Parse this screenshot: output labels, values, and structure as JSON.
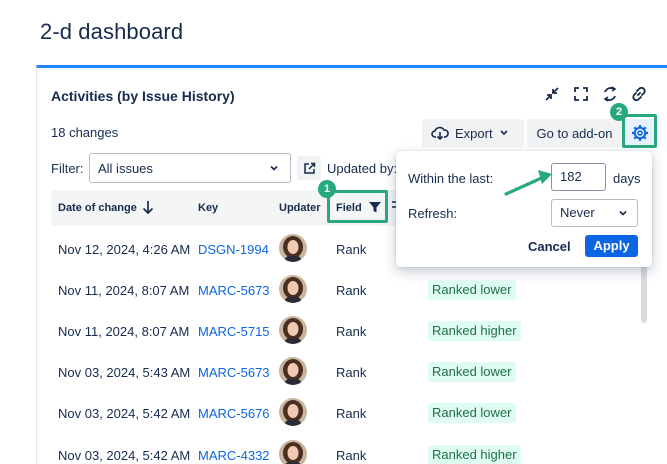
{
  "page": {
    "title": "2-d dashboard"
  },
  "gadget": {
    "title": "Activities (by Issue History)",
    "changes_count": "18 changes",
    "export_label": "Export",
    "addon_label": "Go to add-on",
    "icons": [
      "collapse-icon",
      "fullscreen-icon",
      "refresh-icon",
      "link-icon",
      "external-link-icon",
      "gear-icon",
      "cloud-download-icon",
      "filter-icon",
      "sort-icon",
      "arrow-down-icon",
      "chevron-down-icon"
    ]
  },
  "filter": {
    "label": "Filter:",
    "value": "All issues",
    "updated_by_label": "Updated by:"
  },
  "table": {
    "headers": {
      "date": "Date of change",
      "key": "Key",
      "updater": "Updater",
      "field": "Field"
    },
    "rows": [
      {
        "date": "Nov 12, 2024, 4:26 AM",
        "key": "DSGN-1994",
        "field": "Rank",
        "change": ""
      },
      {
        "date": "Nov 11, 2024, 8:07 AM",
        "key": "MARC-5673",
        "field": "Rank",
        "change": "Ranked lower"
      },
      {
        "date": "Nov 11, 2024, 8:07 AM",
        "key": "MARC-5715",
        "field": "Rank",
        "change": "Ranked higher"
      },
      {
        "date": "Nov 03, 2024, 5:43 AM",
        "key": "MARC-5673",
        "field": "Rank",
        "change": "Ranked lower"
      },
      {
        "date": "Nov 03, 2024, 5:42 AM",
        "key": "MARC-5676",
        "field": "Rank",
        "change": "Ranked lower"
      },
      {
        "date": "Nov 03, 2024, 5:42 AM",
        "key": "MARC-4332",
        "field": "Rank",
        "change": "Ranked higher"
      }
    ]
  },
  "settings_popup": {
    "within_label": "Within the last:",
    "days_value": "182",
    "days_label": "days",
    "refresh_label": "Refresh:",
    "refresh_value": "Never",
    "cancel_label": "Cancel",
    "apply_label": "Apply"
  },
  "annotations": {
    "badge1": "1",
    "badge2": "2",
    "color": "#27a87d"
  },
  "colors": {
    "accent": "#2684ff",
    "link": "#0c66e4",
    "primary": "#0c66e4",
    "badge_bg": "#dffcf0",
    "badge_text": "#216e4e"
  }
}
